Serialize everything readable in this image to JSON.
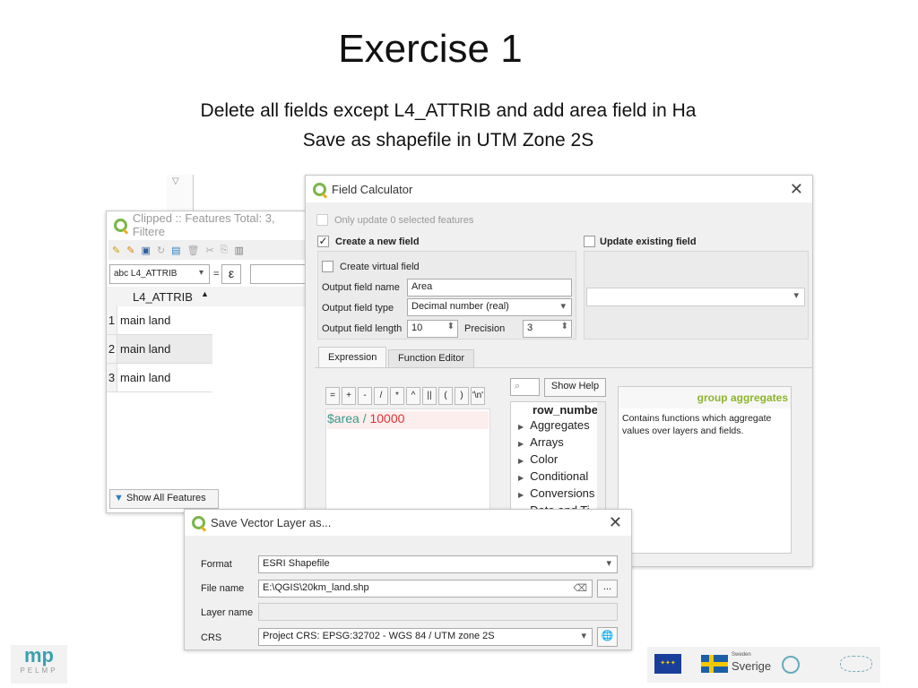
{
  "slide": {
    "title": "Exercise 1",
    "line1": "Delete all fields except L4_ATTRIB and add area field in Ha",
    "line2": "Save as shapefile in UTM Zone 2S"
  },
  "attr_table": {
    "title": "Clipped :: Features Total: 3, Filtere",
    "field_select": "abc L4_ATTRIB",
    "equals": "=",
    "epsilon": "ε",
    "column": "L4_ATTRIB",
    "rows": [
      {
        "n": "1",
        "v": "main land"
      },
      {
        "n": "2",
        "v": "main land"
      },
      {
        "n": "3",
        "v": "main land"
      }
    ],
    "show_all": "Show All Features"
  },
  "field_calc": {
    "title": "Field Calculator",
    "only_update": "Only update 0 selected features",
    "create_new": "Create a new field",
    "create_new_checked": true,
    "update_existing": "Update existing field",
    "virtual": "Create virtual field",
    "name_label": "Output field name",
    "name_value": "Area",
    "type_label": "Output field type",
    "type_value": "Decimal number (real)",
    "length_label": "Output field length",
    "length_value": "10",
    "precision_label": "Precision",
    "precision_value": "3",
    "tabs": [
      "Expression",
      "Function Editor"
    ],
    "operators": [
      "=",
      "+",
      "-",
      "/",
      "*",
      "^",
      "||",
      "(",
      ")",
      "'\\n'"
    ],
    "expr_field": "$area",
    "expr_op": " / ",
    "expr_num": "10000",
    "show_help": "Show Help",
    "functions": [
      "row_numbe",
      "Aggregates",
      "Arrays",
      "Color",
      "Conditional",
      "Conversions",
      "Date and Ti"
    ],
    "help_title": "group aggregates",
    "help_text": "Contains functions which aggregate values over layers and fields.",
    "colors": {
      "help_title": "#8db52b",
      "field": "#3a9a8a",
      "number": "#d33"
    }
  },
  "save_dialog": {
    "title": "Save Vector Layer as...",
    "format_label": "Format",
    "format_value": "ESRI Shapefile",
    "file_label": "File name",
    "file_value": "E:\\QGIS\\20km_land.shp",
    "browse": "...",
    "layer_label": "Layer name",
    "layer_value": "",
    "crs_label": "CRS",
    "crs_value": "Project CRS: EPSG:32702 - WGS 84 / UTM zone 2S"
  },
  "logos": {
    "left": "PELMP",
    "sverige_small": "Sweden",
    "sverige": "Sverige"
  }
}
